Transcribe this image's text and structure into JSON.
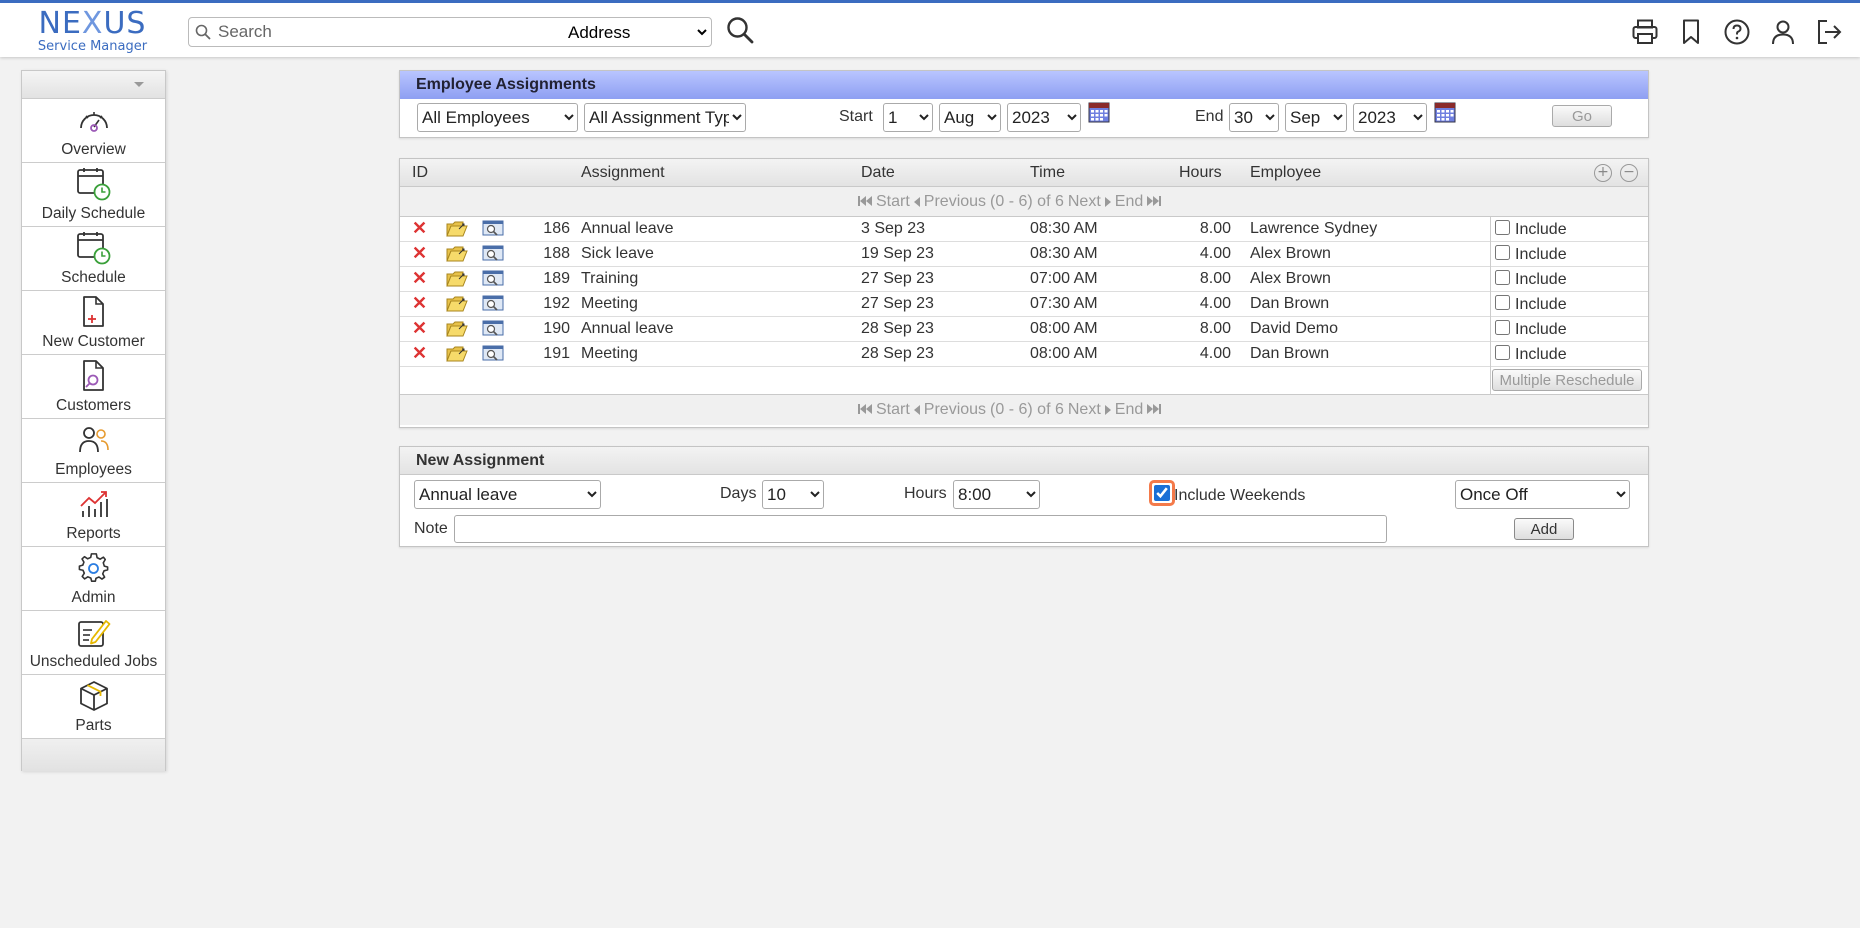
{
  "header": {
    "logo_main": "NEXUS",
    "logo_sub": "Service Manager",
    "search_placeholder": "Search",
    "search_scope": "Address",
    "icons": [
      "print-icon",
      "bookmark-icon",
      "help-icon",
      "user-icon",
      "logout-icon"
    ]
  },
  "sidebar": {
    "items": [
      {
        "label": "Overview",
        "icon": "gauge-icon"
      },
      {
        "label": "Daily Schedule",
        "icon": "calendar-clock-icon"
      },
      {
        "label": "Schedule",
        "icon": "calendar-clock-icon"
      },
      {
        "label": "New Customer",
        "icon": "file-plus-icon"
      },
      {
        "label": "Customers",
        "icon": "file-search-icon"
      },
      {
        "label": "Employees",
        "icon": "people-icon"
      },
      {
        "label": "Reports",
        "icon": "chart-icon"
      },
      {
        "label": "Admin",
        "icon": "gear-icon"
      },
      {
        "label": "Unscheduled Jobs",
        "icon": "edit-icon"
      },
      {
        "label": "Parts",
        "icon": "box-icon"
      }
    ]
  },
  "assignments_panel": {
    "title": "Employee Assignments",
    "employee_filter": "All Employees",
    "type_filter": "All Assignment Typ",
    "start_label": "Start",
    "start_day": "1",
    "start_month": "Aug",
    "start_year": "2023",
    "end_label": "End",
    "end_day": "30",
    "end_month": "Sep",
    "end_year": "2023",
    "go_label": "Go"
  },
  "grid": {
    "headers": {
      "id": "ID",
      "assignment": "Assignment",
      "date": "Date",
      "time": "Time",
      "hours": "Hours",
      "employee": "Employee"
    },
    "pager": {
      "start": "Start",
      "previous": "Previous",
      "info": "(0 - 6) of 6",
      "next": "Next",
      "end": "End"
    },
    "include_label": "Include",
    "rows": [
      {
        "id": "186",
        "assignment": "Annual leave",
        "date": "3 Sep 23",
        "time": "08:30 AM",
        "hours": "8.00",
        "employee": "Lawrence Sydney"
      },
      {
        "id": "188",
        "assignment": "Sick leave",
        "date": "19 Sep 23",
        "time": "08:30 AM",
        "hours": "4.00",
        "employee": "Alex Brown"
      },
      {
        "id": "189",
        "assignment": "Training",
        "date": "27 Sep 23",
        "time": "07:00 AM",
        "hours": "8.00",
        "employee": "Alex Brown"
      },
      {
        "id": "192",
        "assignment": "Meeting",
        "date": "27 Sep 23",
        "time": "07:30 AM",
        "hours": "4.00",
        "employee": "Dan Brown"
      },
      {
        "id": "190",
        "assignment": "Annual leave",
        "date": "28 Sep 23",
        "time": "08:00 AM",
        "hours": "8.00",
        "employee": "David Demo"
      },
      {
        "id": "191",
        "assignment": "Meeting",
        "date": "28 Sep 23",
        "time": "08:00 AM",
        "hours": "4.00",
        "employee": "Dan Brown"
      }
    ],
    "multiple_reschedule_label": "Multiple Reschedule"
  },
  "new_assignment": {
    "title": "New Assignment",
    "type": "Annual leave",
    "days_label": "Days",
    "days": "10",
    "hours_label": "Hours",
    "hours": "8:00",
    "include_weekends_label": "Include Weekends",
    "include_weekends_checked": true,
    "recurrence": "Once Off",
    "note_label": "Note",
    "note_value": "",
    "add_label": "Add"
  }
}
